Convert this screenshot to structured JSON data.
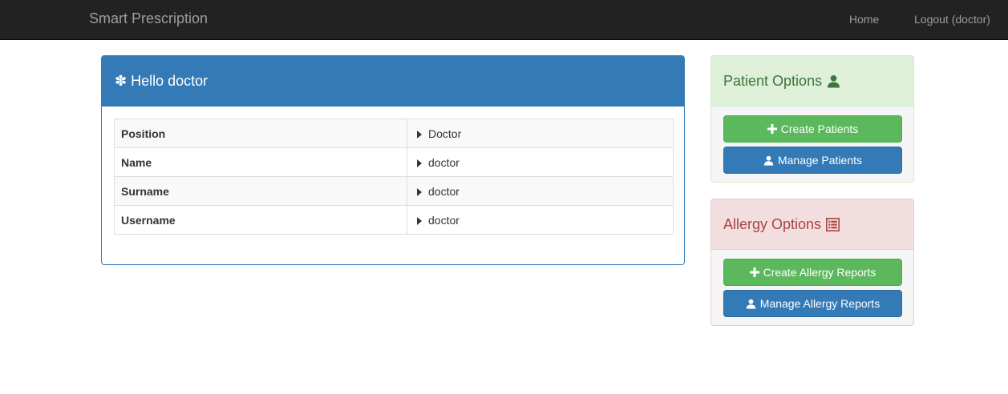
{
  "navbar": {
    "brand": "Smart Prescription",
    "home_label": "Home",
    "logout_label": "Logout (doctor)"
  },
  "profile_panel": {
    "title": "Hello doctor",
    "icon": "asterisk-icon",
    "rows": [
      {
        "label": "Position",
        "value": "Doctor"
      },
      {
        "label": "Name",
        "value": "doctor"
      },
      {
        "label": "Surname",
        "value": "doctor"
      },
      {
        "label": "Username",
        "value": "doctor"
      }
    ]
  },
  "patient_panel": {
    "title": "Patient Options",
    "icon": "user-icon",
    "create_label": "Create Patients",
    "manage_label": "Manage Patients"
  },
  "allergy_panel": {
    "title": "Allergy Options",
    "icon": "list-alt-icon",
    "create_label": "Create Allergy Reports",
    "manage_label": "Manage Allergy Reports"
  },
  "colors": {
    "navbar": "#222222",
    "primary": "#337ab7",
    "success": "#5cb85c",
    "success_heading_bg": "#dff0d8",
    "danger_heading_bg": "#f2dede"
  }
}
